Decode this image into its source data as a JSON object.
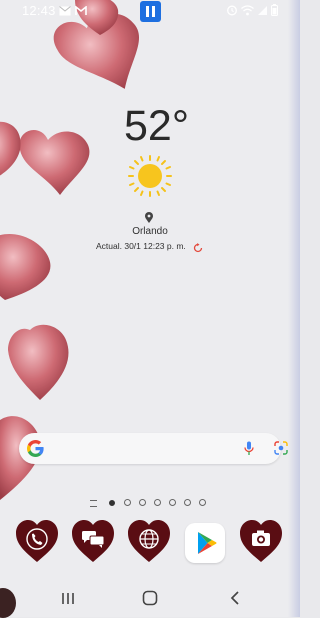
{
  "status_bar": {
    "time": "12:43",
    "left_icons": [
      "mail-icon",
      "gmail-icon"
    ],
    "right_icons": [
      "alarm-icon",
      "wifi-icon",
      "signal-icon",
      "battery-icon"
    ],
    "center_app_icon": "pause-badge-icon"
  },
  "weather": {
    "temperature": "52°",
    "condition_icon": "sun-icon",
    "city": "Orlando",
    "updated": "Actual. 30/1 12:23 p. m."
  },
  "search": {
    "provider_icon": "google-g-icon",
    "voice_icon": "mic-icon",
    "lens_icon": "google-lens-icon"
  },
  "pages": {
    "count": 7,
    "current": 0
  },
  "dock": {
    "apps": [
      {
        "name": "phone",
        "icon": "phone-icon"
      },
      {
        "name": "messages",
        "icon": "messages-icon"
      },
      {
        "name": "browser",
        "icon": "globe-icon"
      },
      {
        "name": "play-store",
        "icon": "play-store-icon"
      },
      {
        "name": "camera",
        "icon": "camera-icon"
      }
    ]
  },
  "navigation": [
    "recent-apps-icon",
    "home-icon",
    "back-icon"
  ],
  "colors": {
    "heart": "#5a0d13",
    "accent": "#1e6fe0",
    "sun": "#f7c51e"
  }
}
